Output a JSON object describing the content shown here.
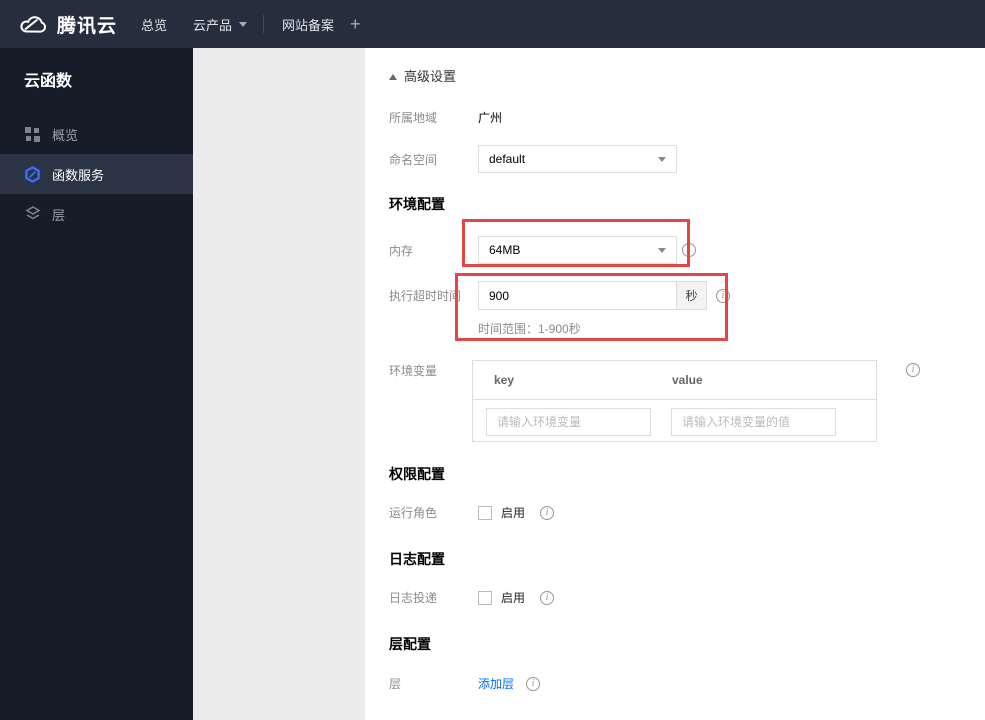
{
  "topbar": {
    "logo_text": "腾讯云",
    "nav_overview": "总览",
    "nav_products": "云产品",
    "nav_icp": "网站备案",
    "plus_label": "+"
  },
  "sidebar": {
    "title": "云函数",
    "items": [
      {
        "label": "概览",
        "icon": "grid-icon",
        "active": false
      },
      {
        "label": "函数服务",
        "icon": "scf-icon",
        "active": true
      },
      {
        "label": "层",
        "icon": "layers-icon",
        "active": false
      }
    ]
  },
  "content": {
    "advanced_settings_label": "高级设置",
    "region_label": "所属地域",
    "region_value": "广州",
    "namespace_label": "命名空间",
    "namespace_value": "default",
    "section_env_config": "环境配置",
    "memory_label": "内存",
    "memory_value": "64MB",
    "timeout_label": "执行超时时间",
    "timeout_value": "900",
    "timeout_unit": "秒",
    "timeout_hint": "时间范围：1-900秒",
    "env_vars_label": "环境变量",
    "env_key_header": "key",
    "env_value_header": "value",
    "env_key_placeholder": "请输入环境变量",
    "env_value_placeholder": "请输入环境变量的值",
    "section_perm_config": "权限配置",
    "run_role_label": "运行角色",
    "run_role_enable": "启用",
    "section_log_config": "日志配置",
    "log_delivery_label": "日志投递",
    "log_delivery_enable": "启用",
    "section_layer_config": "层配置",
    "layer_label": "层",
    "add_layer_link": "添加层"
  },
  "colors": {
    "highlight_red": "#e64545",
    "link_blue": "#006eff",
    "active_icon_blue": "#3d6eff",
    "topbar_bg": "#262e3d",
    "sidebar_bg": "#161d29"
  }
}
